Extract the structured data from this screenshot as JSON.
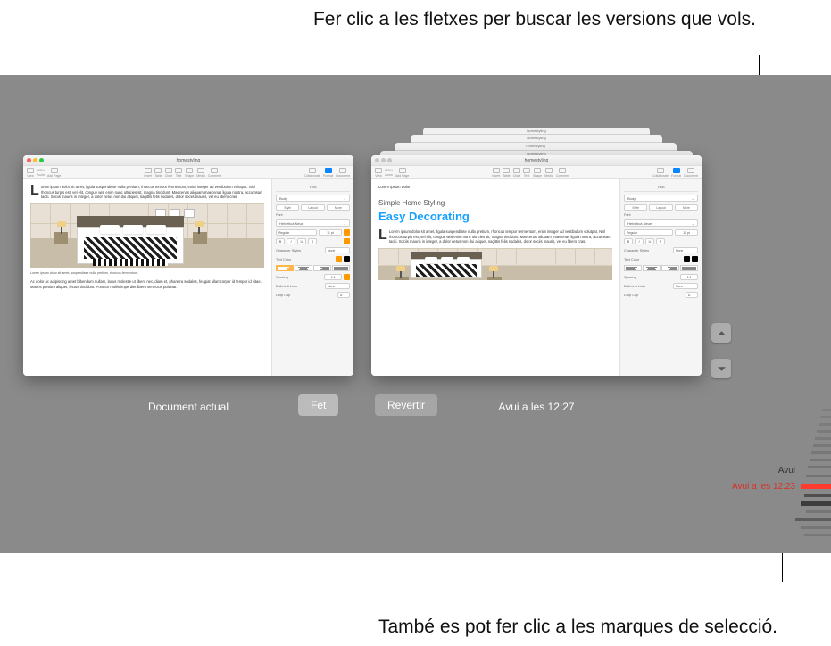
{
  "callouts": {
    "top": "Fer clic a les fletxes per buscar les versions que vols.",
    "bottom": "També es pot fer clic a les marques de selecció."
  },
  "window": {
    "title": "homestyling",
    "toolbar_items": [
      "View",
      "Zoom",
      "Add Page",
      "Insert",
      "Table",
      "Chart",
      "Text",
      "Shape",
      "Media",
      "Comment",
      "Collaborate",
      "Format",
      "Document"
    ],
    "zoom": "125%"
  },
  "left_doc": {
    "label": "Document actual",
    "para1": "orem ipsum dolor sit amet, ligula suspendisse nulla pretium, rhoncus tempor fermentum, enim integer ad vestibulum volutpat. Nisl rhoncus turpis est, vel elit, congue wisi enim nunc ultricies sit, magna tincidunt. Maecenas aliquam maecenas ligula nostra, accumsan taciti. Sociis mauris in integer, a dolor netus non dui aliquet, sagittis felis sodales, dolor sociis mauris, vel eu libero cras.",
    "caption": "Lorem ipsum dolor sit amet, suspendisse nulla pretium, rhoncus fermentum.",
    "para2": "Ac dolor ac adipiscing amet bibendum nullam, lacus molestie ut libero nec, diam et, pharetra sodales, feugiat ullamcorper id tempor id vitae. Mauris pretium aliquet, lectus tincidunt. Porttitor mollis imperdiet libero senectus pulvinar."
  },
  "right_doc": {
    "label": "Avui a les 12:27",
    "toptext": "Lorem Ipsum Dolor",
    "subtitle": "Simple Home Styling",
    "bigtitle": "Easy Decorating",
    "para1": "Lorem ipsum dolor sit amet, ligula suspendisse nulla pretium, rhoncus tempor fermentum, enim integer ad vestibulum volutpat. Nisl rhoncus turpis est, vel elit, congue wisi enim nunc ultricies sit, magna tincidunt. Maecenas aliquam maecenas ligula nostra, accumsan taciti. Sociis mauris in integer, a dolor netus non dui aliquet, sagittis felis sodales, dolor sociis mauris, vel eu libero cras."
  },
  "inspector": {
    "tab": "Text",
    "style_main": "Body",
    "segments": [
      "Style",
      "Layout",
      "More"
    ],
    "font_label": "Font",
    "font_family": "Helvetica Neue",
    "font_weight": "Regular",
    "font_size": "11 pt",
    "char_styles_label": "Character Styles",
    "char_styles_value": "None",
    "text_color_label": "Text Color",
    "spacing_label": "Spacing",
    "spacing_value": "1.1",
    "bullets_label": "Bullets & Lists",
    "bullets_value": "None",
    "dropcap_label": "Drop Cap"
  },
  "buttons": {
    "done": "Fet",
    "revert": "Revertir"
  },
  "timeline": {
    "today": "Avui",
    "selected": "Avui a les 12:23"
  }
}
